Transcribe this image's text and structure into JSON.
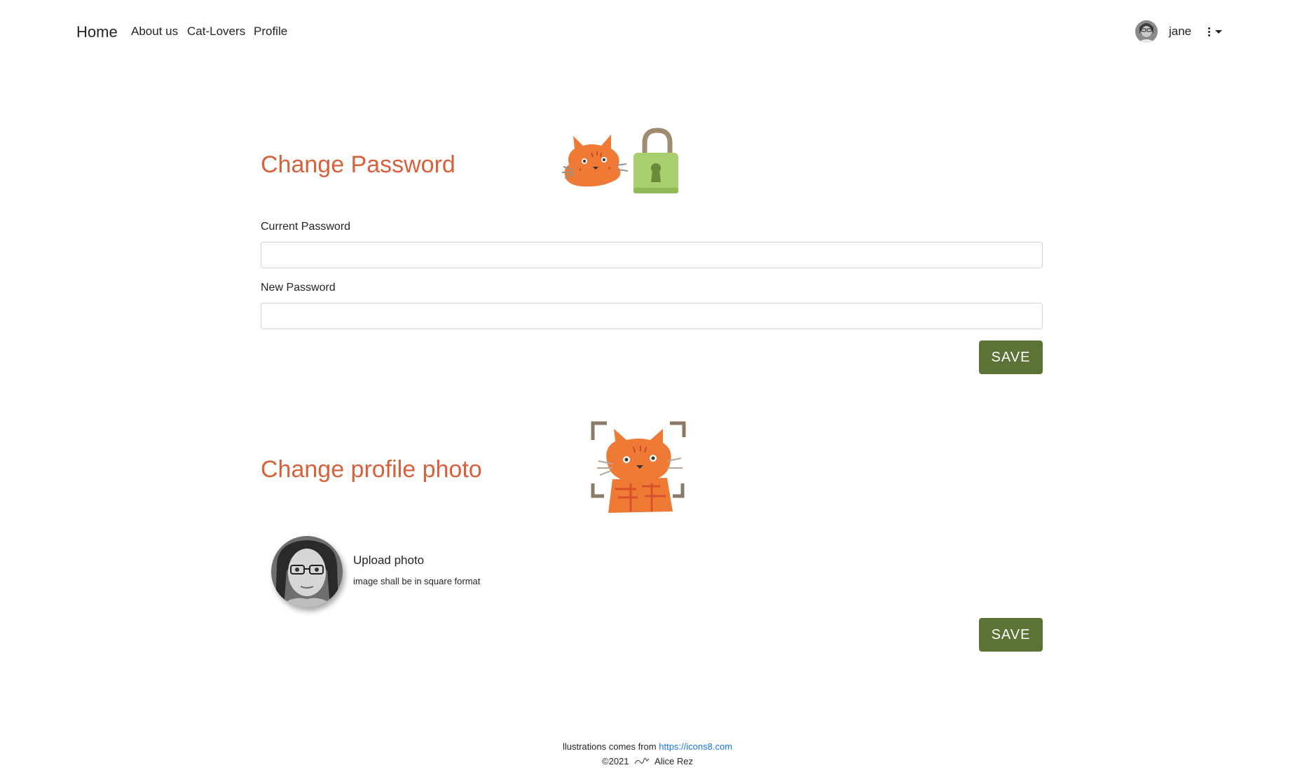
{
  "nav": {
    "brand": "Home",
    "links": [
      "About us",
      "Cat-Lovers",
      "Profile"
    ],
    "user_name": "jane",
    "avatar_icon": "user-avatar-photo",
    "menu_icon": "kebab-menu-icon"
  },
  "password_section": {
    "title": "Change Password",
    "illustration": "cat-with-padlock-icon",
    "current_label": "Current Password",
    "current_value": "",
    "new_label": "New Password",
    "new_value": "",
    "save_label": "SAVE"
  },
  "photo_section": {
    "title": "Change profile photo",
    "illustration": "cat-photo-scan-icon",
    "upload_label": "Upload photo",
    "upload_hint": "image shall be in square format",
    "save_label": "SAVE"
  },
  "footer": {
    "credit_text": "llustrations comes from",
    "credit_link": "https://icons8.com",
    "copyright": "©2021",
    "author": "Alice Rez"
  },
  "colors": {
    "title": "#d9603b",
    "save_button": "#5b7334",
    "link": "#1a73e8"
  }
}
